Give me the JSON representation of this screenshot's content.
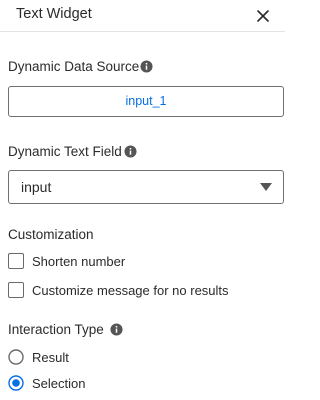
{
  "header": {
    "title": "Text Widget",
    "close_icon": "close-icon"
  },
  "data_source": {
    "label": "Dynamic Data Source",
    "value": "input_1",
    "info_icon": "info-icon"
  },
  "text_field": {
    "label": "Dynamic Text Field",
    "selected": "input",
    "info_icon": "info-icon",
    "caret_icon": "chevron-down-icon"
  },
  "customization": {
    "label": "Customization",
    "options": [
      {
        "label": "Shorten number",
        "checked": false
      },
      {
        "label": "Customize message for no results",
        "checked": false
      }
    ]
  },
  "interaction": {
    "label": "Interaction Type",
    "info_icon": "info-icon",
    "options": [
      {
        "label": "Result",
        "selected": false
      },
      {
        "label": "Selection",
        "selected": true
      }
    ]
  },
  "colors": {
    "accent": "#076fe5",
    "text": "#2b2b2b",
    "border": "#6f6f6f",
    "icon": "#555555"
  }
}
